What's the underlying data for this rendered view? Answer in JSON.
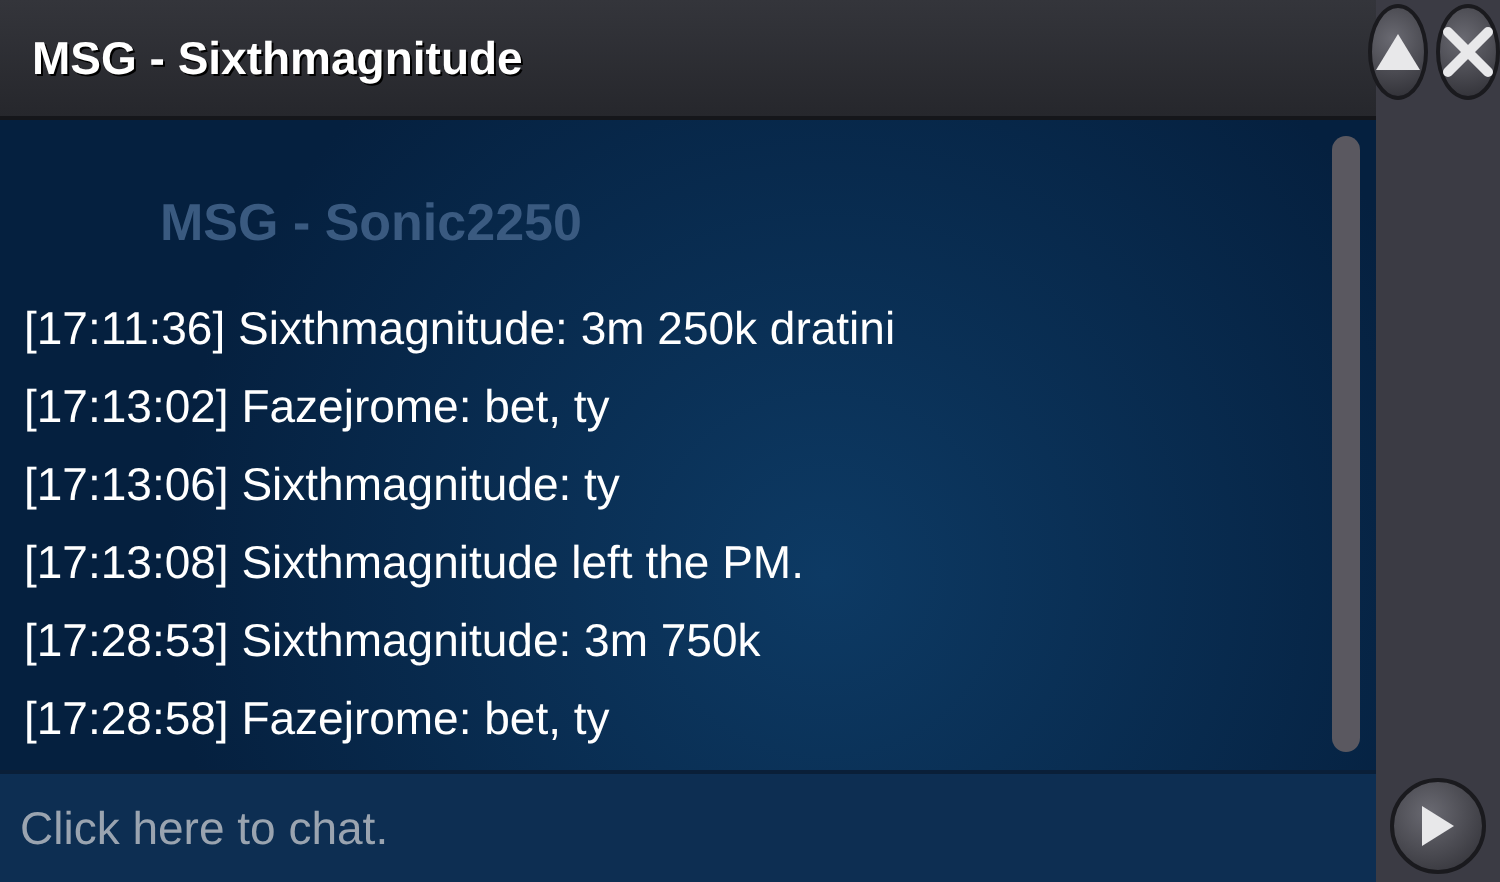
{
  "window": {
    "title": "MSG - Sixthmagnitude"
  },
  "background_window": {
    "title": "MSG - Sonic2250"
  },
  "messages": [
    {
      "time": "[17:11:36]",
      "text": "Sixthmagnitude: 3m 250k dratini"
    },
    {
      "time": "[17:13:02]",
      "text": "Fazejrome: bet, ty"
    },
    {
      "time": "[17:13:06]",
      "text": "Sixthmagnitude: ty"
    },
    {
      "time": "[17:13:08]",
      "text": "Sixthmagnitude left the PM."
    },
    {
      "time": "[17:28:53]",
      "text": "Sixthmagnitude: 3m 750k"
    },
    {
      "time": "[17:28:58]",
      "text": "Fazejrome: bet, ty"
    }
  ],
  "chat_input": {
    "placeholder": "Click here to chat."
  }
}
